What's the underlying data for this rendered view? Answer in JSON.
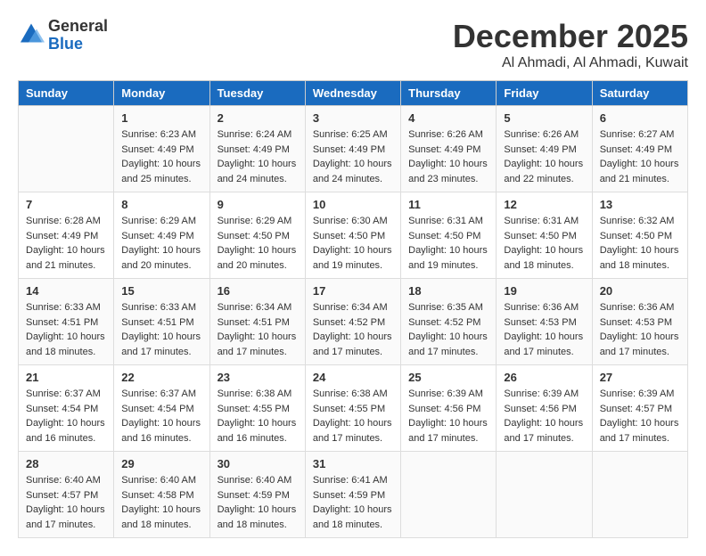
{
  "header": {
    "logo": {
      "general": "General",
      "blue": "Blue"
    },
    "title": "December 2025",
    "subtitle": "Al Ahmadi, Al Ahmadi, Kuwait"
  },
  "calendar": {
    "days_of_week": [
      "Sunday",
      "Monday",
      "Tuesday",
      "Wednesday",
      "Thursday",
      "Friday",
      "Saturday"
    ],
    "weeks": [
      [
        {
          "day": "",
          "info": ""
        },
        {
          "day": "1",
          "info": "Sunrise: 6:23 AM\nSunset: 4:49 PM\nDaylight: 10 hours\nand 25 minutes."
        },
        {
          "day": "2",
          "info": "Sunrise: 6:24 AM\nSunset: 4:49 PM\nDaylight: 10 hours\nand 24 minutes."
        },
        {
          "day": "3",
          "info": "Sunrise: 6:25 AM\nSunset: 4:49 PM\nDaylight: 10 hours\nand 24 minutes."
        },
        {
          "day": "4",
          "info": "Sunrise: 6:26 AM\nSunset: 4:49 PM\nDaylight: 10 hours\nand 23 minutes."
        },
        {
          "day": "5",
          "info": "Sunrise: 6:26 AM\nSunset: 4:49 PM\nDaylight: 10 hours\nand 22 minutes."
        },
        {
          "day": "6",
          "info": "Sunrise: 6:27 AM\nSunset: 4:49 PM\nDaylight: 10 hours\nand 21 minutes."
        }
      ],
      [
        {
          "day": "7",
          "info": "Sunrise: 6:28 AM\nSunset: 4:49 PM\nDaylight: 10 hours\nand 21 minutes."
        },
        {
          "day": "8",
          "info": "Sunrise: 6:29 AM\nSunset: 4:49 PM\nDaylight: 10 hours\nand 20 minutes."
        },
        {
          "day": "9",
          "info": "Sunrise: 6:29 AM\nSunset: 4:50 PM\nDaylight: 10 hours\nand 20 minutes."
        },
        {
          "day": "10",
          "info": "Sunrise: 6:30 AM\nSunset: 4:50 PM\nDaylight: 10 hours\nand 19 minutes."
        },
        {
          "day": "11",
          "info": "Sunrise: 6:31 AM\nSunset: 4:50 PM\nDaylight: 10 hours\nand 19 minutes."
        },
        {
          "day": "12",
          "info": "Sunrise: 6:31 AM\nSunset: 4:50 PM\nDaylight: 10 hours\nand 18 minutes."
        },
        {
          "day": "13",
          "info": "Sunrise: 6:32 AM\nSunset: 4:50 PM\nDaylight: 10 hours\nand 18 minutes."
        }
      ],
      [
        {
          "day": "14",
          "info": "Sunrise: 6:33 AM\nSunset: 4:51 PM\nDaylight: 10 hours\nand 18 minutes."
        },
        {
          "day": "15",
          "info": "Sunrise: 6:33 AM\nSunset: 4:51 PM\nDaylight: 10 hours\nand 17 minutes."
        },
        {
          "day": "16",
          "info": "Sunrise: 6:34 AM\nSunset: 4:51 PM\nDaylight: 10 hours\nand 17 minutes."
        },
        {
          "day": "17",
          "info": "Sunrise: 6:34 AM\nSunset: 4:52 PM\nDaylight: 10 hours\nand 17 minutes."
        },
        {
          "day": "18",
          "info": "Sunrise: 6:35 AM\nSunset: 4:52 PM\nDaylight: 10 hours\nand 17 minutes."
        },
        {
          "day": "19",
          "info": "Sunrise: 6:36 AM\nSunset: 4:53 PM\nDaylight: 10 hours\nand 17 minutes."
        },
        {
          "day": "20",
          "info": "Sunrise: 6:36 AM\nSunset: 4:53 PM\nDaylight: 10 hours\nand 17 minutes."
        }
      ],
      [
        {
          "day": "21",
          "info": "Sunrise: 6:37 AM\nSunset: 4:54 PM\nDaylight: 10 hours\nand 16 minutes."
        },
        {
          "day": "22",
          "info": "Sunrise: 6:37 AM\nSunset: 4:54 PM\nDaylight: 10 hours\nand 16 minutes."
        },
        {
          "day": "23",
          "info": "Sunrise: 6:38 AM\nSunset: 4:55 PM\nDaylight: 10 hours\nand 16 minutes."
        },
        {
          "day": "24",
          "info": "Sunrise: 6:38 AM\nSunset: 4:55 PM\nDaylight: 10 hours\nand 17 minutes."
        },
        {
          "day": "25",
          "info": "Sunrise: 6:39 AM\nSunset: 4:56 PM\nDaylight: 10 hours\nand 17 minutes."
        },
        {
          "day": "26",
          "info": "Sunrise: 6:39 AM\nSunset: 4:56 PM\nDaylight: 10 hours\nand 17 minutes."
        },
        {
          "day": "27",
          "info": "Sunrise: 6:39 AM\nSunset: 4:57 PM\nDaylight: 10 hours\nand 17 minutes."
        }
      ],
      [
        {
          "day": "28",
          "info": "Sunrise: 6:40 AM\nSunset: 4:57 PM\nDaylight: 10 hours\nand 17 minutes."
        },
        {
          "day": "29",
          "info": "Sunrise: 6:40 AM\nSunset: 4:58 PM\nDaylight: 10 hours\nand 18 minutes."
        },
        {
          "day": "30",
          "info": "Sunrise: 6:40 AM\nSunset: 4:59 PM\nDaylight: 10 hours\nand 18 minutes."
        },
        {
          "day": "31",
          "info": "Sunrise: 6:41 AM\nSunset: 4:59 PM\nDaylight: 10 hours\nand 18 minutes."
        },
        {
          "day": "",
          "info": ""
        },
        {
          "day": "",
          "info": ""
        },
        {
          "day": "",
          "info": ""
        }
      ]
    ]
  }
}
